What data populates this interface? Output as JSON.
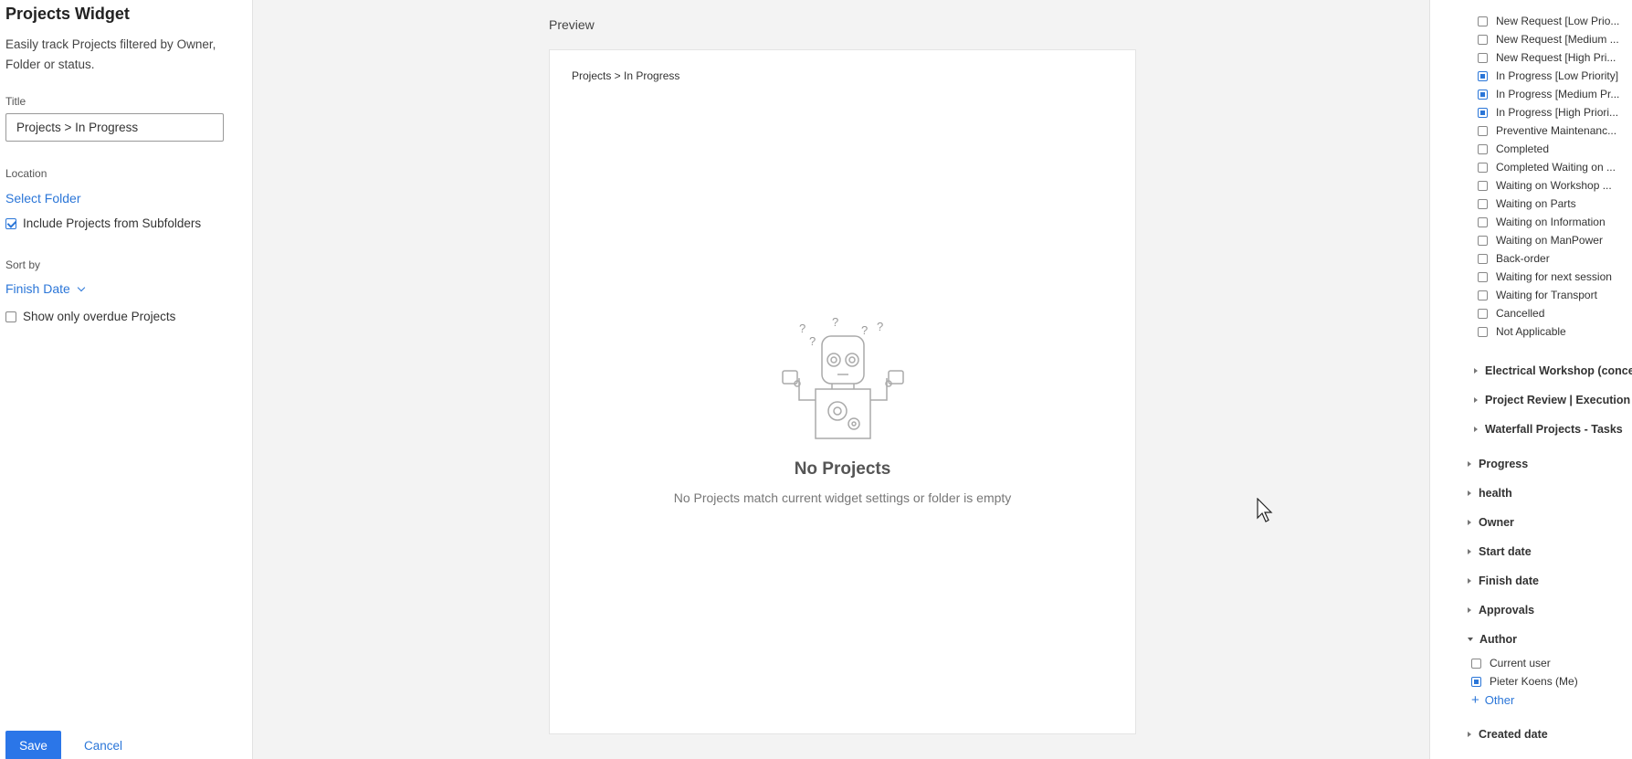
{
  "left_panel": {
    "heading": "Projects Widget",
    "description": "Easily track Projects filtered by Owner, Folder or status.",
    "title_label": "Title",
    "title_value": "Projects > In Progress",
    "location_label": "Location",
    "select_folder": "Select Folder",
    "include_subfolders_label": "Include Projects from Subfolders",
    "include_subfolders_checked": true,
    "sort_label": "Sort by",
    "sort_value": "Finish Date",
    "overdue_label": "Show only overdue Projects",
    "overdue_checked": false,
    "save_label": "Save",
    "cancel_label": "Cancel"
  },
  "preview": {
    "label": "Preview",
    "widget_title": "Projects > In Progress",
    "empty_title": "No Projects",
    "empty_subtitle": "No Projects match current widget settings or folder is empty"
  },
  "right_panel": {
    "statuses": [
      {
        "label": "New Request [Low Prio...",
        "checked": false
      },
      {
        "label": "New Request [Medium ...",
        "checked": false
      },
      {
        "label": "New Request [High Pri...",
        "checked": false
      },
      {
        "label": "In Progress [Low Priority]",
        "checked": true
      },
      {
        "label": "In Progress [Medium Pr...",
        "checked": true
      },
      {
        "label": "In Progress [High Priori...",
        "checked": true
      },
      {
        "label": "Preventive Maintenanc...",
        "checked": false
      },
      {
        "label": "Completed",
        "checked": false
      },
      {
        "label": "Completed Waiting on ...",
        "checked": false
      },
      {
        "label": "Waiting on Workshop ...",
        "checked": false
      },
      {
        "label": "Waiting on Parts",
        "checked": false
      },
      {
        "label": "Waiting on Information",
        "checked": false
      },
      {
        "label": "Waiting on ManPower",
        "checked": false
      },
      {
        "label": "Back-order",
        "checked": false
      },
      {
        "label": "Waiting for next session",
        "checked": false
      },
      {
        "label": "Waiting for Transport",
        "checked": false
      },
      {
        "label": "Cancelled",
        "checked": false
      },
      {
        "label": "Not Applicable",
        "checked": false
      }
    ],
    "workflows": [
      {
        "label": "Electrical Workshop (concep"
      },
      {
        "label": "Project Review | Execution"
      },
      {
        "label": "Waterfall Projects - Tasks"
      }
    ],
    "groups": [
      {
        "label": "Progress"
      },
      {
        "label": "health"
      },
      {
        "label": "Owner"
      },
      {
        "label": "Start date"
      },
      {
        "label": "Finish date"
      },
      {
        "label": "Approvals"
      }
    ],
    "author": {
      "label": "Author",
      "items": [
        {
          "label": "Current user",
          "checked": false
        },
        {
          "label": "Pieter Koens (Me)",
          "checked": true
        }
      ],
      "other_label": "Other"
    },
    "created_date_label": "Created date"
  },
  "colors": {
    "accent": "#2b76d8",
    "save_button": "#2b76e8",
    "background": "#f3f3f3"
  }
}
